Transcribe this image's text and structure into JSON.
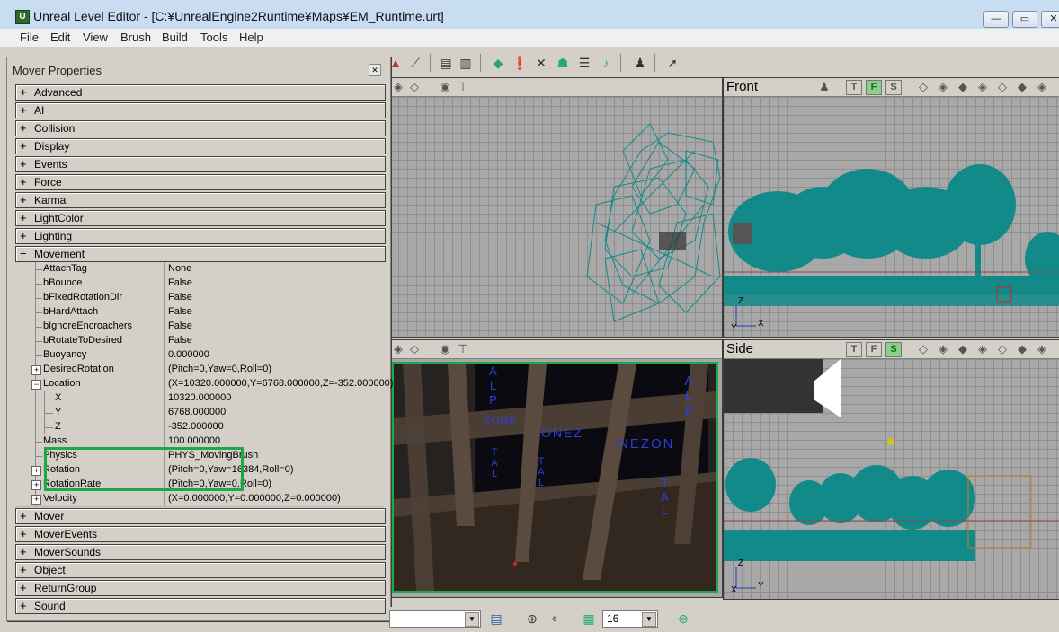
{
  "window": {
    "app_icon": "unreal-editor-icon",
    "title": "Unreal Level Editor - [C:¥UnrealEngine2Runtime¥Maps¥EM_Runtime.urt]",
    "controls": {
      "minimize": "minimize-icon",
      "maximize": "maximize-icon",
      "close": "close-icon"
    }
  },
  "menubar": [
    "File",
    "Edit",
    "View",
    "Brush",
    "Build",
    "Tools",
    "Help"
  ],
  "viewports": {
    "front": {
      "label": "Front",
      "axis_v": "Z",
      "axis_h": "X",
      "axis_y": "Y"
    },
    "side": {
      "label": "Side",
      "axis_v": "Z",
      "axis_h": "Y",
      "axis_y": "X"
    },
    "view_buttons": {
      "t": "T",
      "f": "F",
      "s": "S"
    },
    "perspective_text": [
      "ALP",
      "ONEZ",
      "NEZON",
      "ZONE",
      "ALP",
      "TAL",
      "TAL",
      "TAL"
    ]
  },
  "mover_panel": {
    "title": "Mover Properties",
    "categories_top": [
      "Advanced",
      "AI",
      "Collision",
      "Display",
      "Events",
      "Force",
      "Karma",
      "LightColor",
      "Lighting"
    ],
    "expanded_category": "Movement",
    "movement_rows": [
      {
        "name": "AttachTag",
        "value": "None"
      },
      {
        "name": "bBounce",
        "value": "False"
      },
      {
        "name": "bFixedRotationDir",
        "value": "False"
      },
      {
        "name": "bHardAttach",
        "value": "False"
      },
      {
        "name": "bIgnoreEncroachers",
        "value": "False"
      },
      {
        "name": "bRotateToDesired",
        "value": "False"
      },
      {
        "name": "Buoyancy",
        "value": "0.000000"
      },
      {
        "name": "DesiredRotation",
        "value": "(Pitch=0,Yaw=0,Roll=0)"
      },
      {
        "name": "Location",
        "value": "(X=10320.000000,Y=6768.000000,Z=-352.000000)"
      },
      {
        "name": "X",
        "value": "10320.000000"
      },
      {
        "name": "Y",
        "value": "6768.000000"
      },
      {
        "name": "Z",
        "value": "-352.000000"
      },
      {
        "name": "Mass",
        "value": "100.000000"
      },
      {
        "name": "Physics",
        "value": "PHYS_MovingBrush"
      },
      {
        "name": "Rotation",
        "value": "(Pitch=0,Yaw=16384,Roll=0)"
      },
      {
        "name": "RotationRate",
        "value": "(Pitch=0,Yaw=0,Roll=0)"
      },
      {
        "name": "Velocity",
        "value": "(X=0.000000,Y=0.000000,Z=0.000000)"
      }
    ],
    "categories_bottom": [
      "Mover",
      "MoverEvents",
      "MoverSounds",
      "Object",
      "ReturnGroup",
      "Sound"
    ]
  },
  "statusbar": {
    "grid_size": "16"
  },
  "colors": {
    "foliage": "#138a8a",
    "highlight": "#1fa84a",
    "viewport_bg": "#a8a8a8"
  }
}
